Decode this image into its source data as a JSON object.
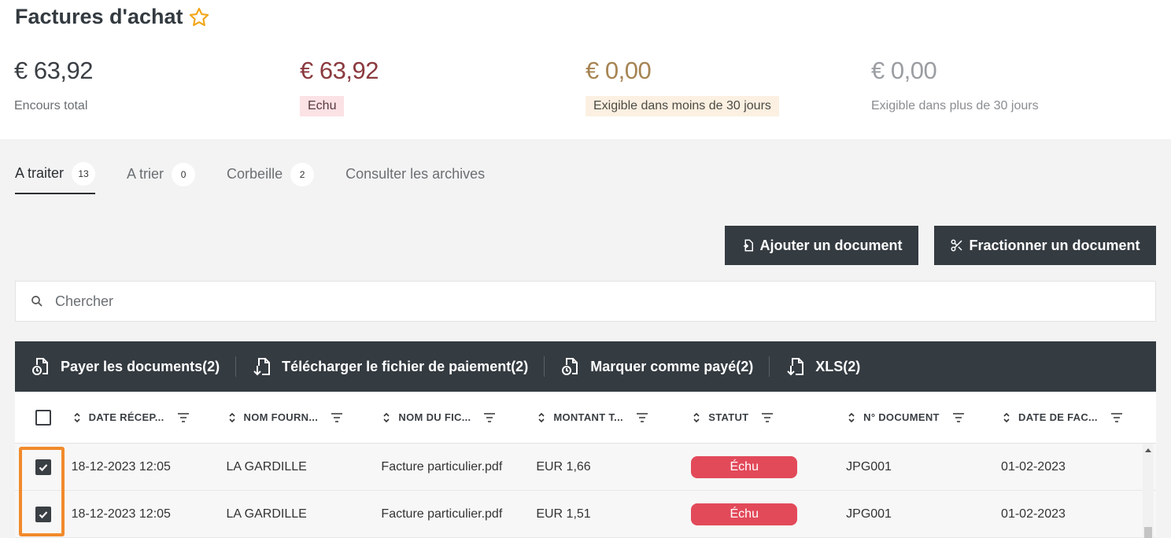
{
  "page": {
    "title": "Factures d'achat"
  },
  "stats": [
    {
      "amount": "€ 63,92",
      "label": "Encours total"
    },
    {
      "amount": "€ 63,92",
      "label": "Echu"
    },
    {
      "amount": "€ 0,00",
      "label": "Exigible dans moins de 30 jours"
    },
    {
      "amount": "€ 0,00",
      "label": "Exigible dans plus de 30 jours"
    }
  ],
  "tabs": [
    {
      "label": "A traiter",
      "count": "13"
    },
    {
      "label": "A trier",
      "count": "0"
    },
    {
      "label": "Corbeille",
      "count": "2"
    },
    {
      "label": "Consulter les archives"
    }
  ],
  "buttons": {
    "add_document": "Ajouter un document",
    "split_document": "Fractionner un document"
  },
  "search": {
    "placeholder": "Chercher"
  },
  "actions": [
    {
      "label": "Payer les documents(2)",
      "icon": "pay-document-icon"
    },
    {
      "label": "Télécharger le fichier de paiement(2)",
      "icon": "download-icon"
    },
    {
      "label": "Marquer comme payé(2)",
      "icon": "mark-paid-icon"
    },
    {
      "label": "XLS(2)",
      "icon": "xls-download-icon"
    }
  ],
  "table": {
    "columns": [
      "DATE RÉCEP...",
      "NOM FOURN...",
      "NOM DU FIC...",
      "MONTANT T...",
      "STATUT",
      "N° DOCUMENT",
      "DATE DE FAC..."
    ],
    "rows": [
      {
        "checked": true,
        "cells": [
          "18-12-2023 12:05",
          "LA GARDILLE",
          "Facture particulier.pdf",
          "EUR 1,66",
          "Échu",
          "JPG001",
          "01-02-2023"
        ]
      },
      {
        "checked": true,
        "cells": [
          "18-12-2023 12:05",
          "LA GARDILLE",
          "Facture particulier.pdf",
          "EUR 1,51",
          "Échu",
          "JPG001",
          "01-02-2023"
        ]
      }
    ]
  },
  "colors": {
    "dark": "#343b41",
    "overdue": "#e24a5a",
    "highlight": "#f28a2b",
    "star": "#f2a516"
  }
}
